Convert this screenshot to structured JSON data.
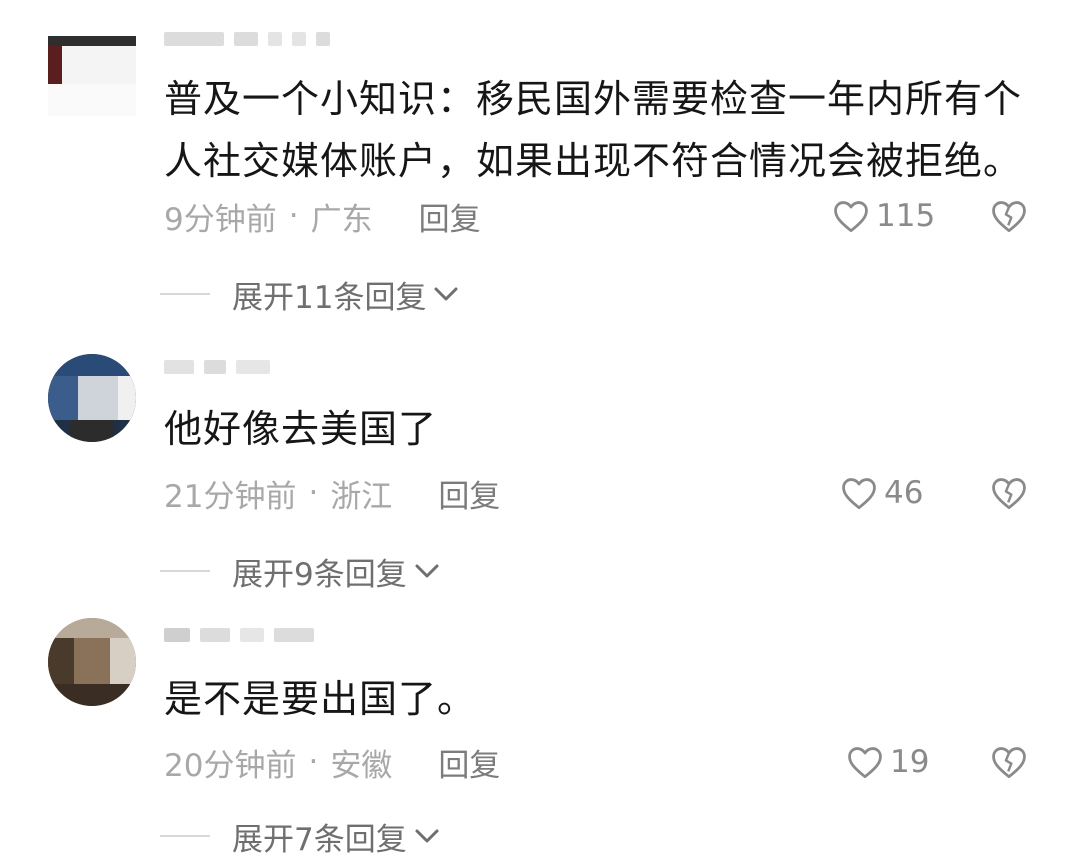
{
  "comments": [
    {
      "text": "普及一个小知识：移民国外需要检查一年内所有个人社交媒体账户，如果出现不符合情况会被拒绝。",
      "time": "9分钟前",
      "location": "广东",
      "reply_label": "回复",
      "likes": "115",
      "expand_label": "展开11条回复"
    },
    {
      "text": "他好像去美国了",
      "time": "21分钟前",
      "location": "浙江",
      "reply_label": "回复",
      "likes": "46",
      "expand_label": "展开9条回复"
    },
    {
      "text": "是不是要出国了。",
      "time": "20分钟前",
      "location": "安徽",
      "reply_label": "回复",
      "likes": "19",
      "expand_label": "展开7条回复"
    }
  ],
  "meta_separator": "·",
  "icons": {
    "like": "heart-outline-icon",
    "dislike": "broken-heart-icon",
    "expand": "chevron-down-icon"
  },
  "colors": {
    "text": "#161616",
    "meta": "#a8a8a8",
    "reply": "#7c7c7c",
    "icon": "#8a8a8a"
  }
}
